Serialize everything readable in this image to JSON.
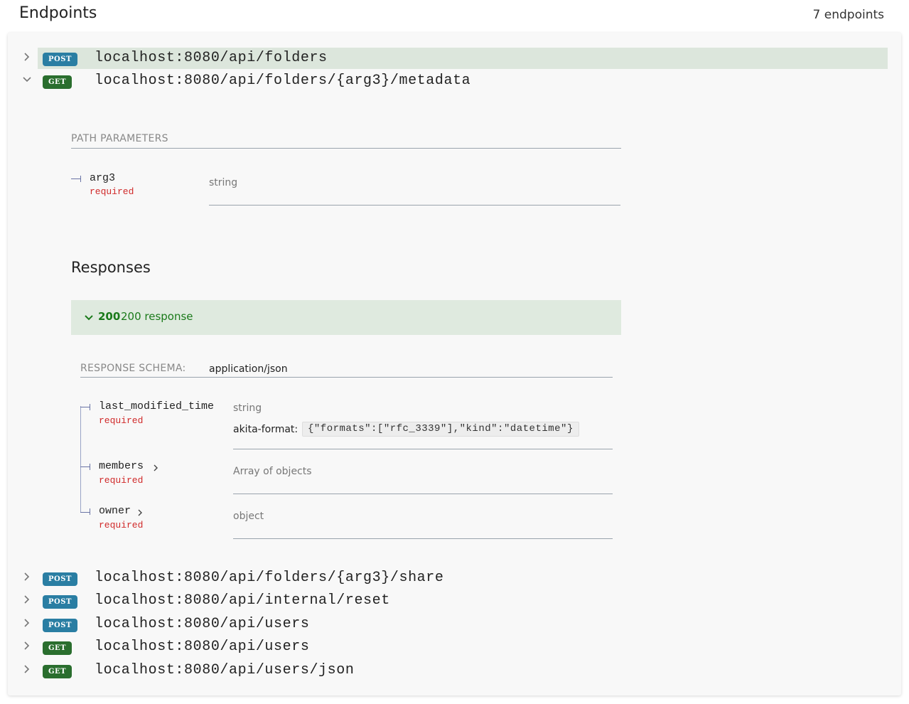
{
  "header": {
    "title": "Endpoints",
    "count": "7 endpoints"
  },
  "colors": {
    "post": "#2a7ea3",
    "get": "#2a6e2e",
    "required": "#d02a2a",
    "response_green": "#1a7a1a",
    "highlight": "#dce6dc"
  },
  "endpoints": [
    {
      "method": "POST",
      "path": "localhost:8080/api/folders",
      "expanded": false,
      "highlighted": true
    },
    {
      "method": "GET",
      "path": "localhost:8080/api/folders/{arg3}/metadata",
      "expanded": true
    },
    {
      "method": "POST",
      "path": "localhost:8080/api/folders/{arg3}/share",
      "expanded": false
    },
    {
      "method": "POST",
      "path": "localhost:8080/api/internal/reset",
      "expanded": false
    },
    {
      "method": "POST",
      "path": "localhost:8080/api/users",
      "expanded": false
    },
    {
      "method": "GET",
      "path": "localhost:8080/api/users",
      "expanded": false
    },
    {
      "method": "GET",
      "path": "localhost:8080/api/users/json",
      "expanded": false
    }
  ],
  "detail": {
    "path_params_label": "PATH PARAMETERS",
    "path_params": [
      {
        "name": "arg3",
        "required": "required",
        "type": "string"
      }
    ],
    "responses_title": "Responses",
    "response": {
      "code": "200",
      "description": "200 response"
    },
    "schema_label": "RESPONSE SCHEMA:",
    "schema_type": "application/json",
    "fields": [
      {
        "name": "last_modified_time",
        "required": "required",
        "type": "string",
        "akita_label": "akita-format:",
        "akita_value": "{\"formats\":[\"rfc_3339\"],\"kind\":\"datetime\"}"
      },
      {
        "name": "members",
        "required": "required",
        "type": "Array of objects"
      },
      {
        "name": "owner",
        "required": "required",
        "type": "object"
      }
    ]
  }
}
